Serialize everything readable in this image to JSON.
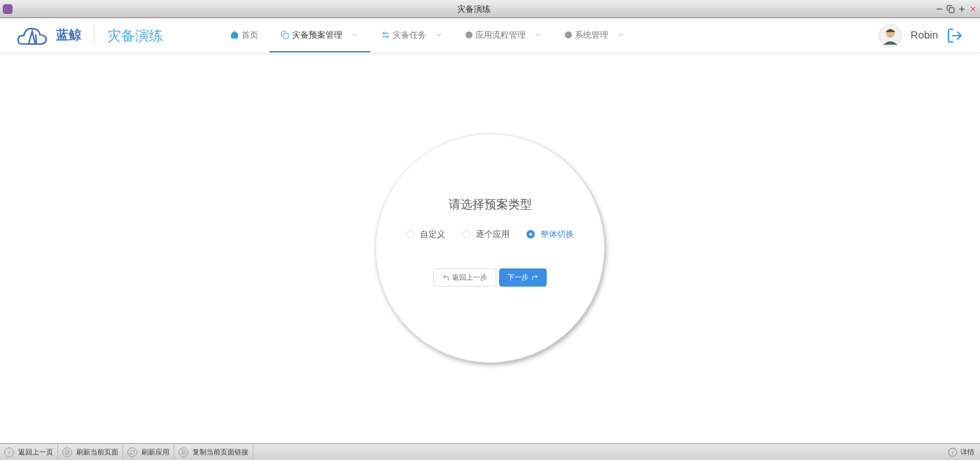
{
  "window": {
    "title": "灾备演练"
  },
  "header": {
    "brand": "蓝鲸",
    "app_title": "灾备演练",
    "user": "Robin"
  },
  "nav": [
    {
      "label": "首页",
      "dropdown": false,
      "selected": false
    },
    {
      "label": "灾备预案管理",
      "dropdown": true,
      "selected": true
    },
    {
      "label": "灾备任务",
      "dropdown": true,
      "selected": false
    },
    {
      "label": "应用流程管理",
      "dropdown": true,
      "selected": false
    },
    {
      "label": "系统管理",
      "dropdown": true,
      "selected": false
    }
  ],
  "dialog": {
    "title": "请选择预案类型",
    "options": [
      {
        "label": "自定义",
        "selected": false
      },
      {
        "label": "逐个应用",
        "selected": false
      },
      {
        "label": "整体切换",
        "selected": true
      }
    ],
    "buttons": [
      {
        "label": "返回上一步",
        "kind": "back"
      },
      {
        "label": "下一步",
        "kind": "next"
      }
    ]
  },
  "status_bar": {
    "items": [
      {
        "label": "返回上一页"
      },
      {
        "label": "刷新当前页面"
      },
      {
        "label": "刷新应用"
      },
      {
        "label": "复制当前页面链接"
      }
    ],
    "details": "详情"
  }
}
